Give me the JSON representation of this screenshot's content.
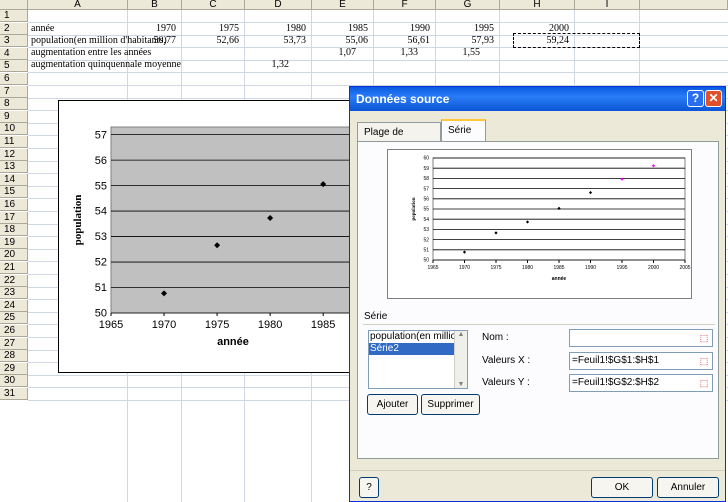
{
  "sheet": {
    "columns": [
      "A",
      "B",
      "C",
      "D",
      "E",
      "F",
      "G",
      "H",
      "I"
    ],
    "rows": [
      "1",
      "2",
      "3",
      "4",
      "5",
      "6",
      "7",
      "8",
      "9",
      "10",
      "11",
      "12",
      "13",
      "14",
      "15",
      "16",
      "17",
      "18",
      "19",
      "20",
      "21",
      "22",
      "23",
      "24",
      "25",
      "26",
      "27",
      "28",
      "29",
      "30",
      "31"
    ],
    "labels": {
      "r1": "année",
      "r2": "population(en million d'habitants)",
      "r3": "augmentation entre les années",
      "r4": "augmentation quinquennale moyenne"
    },
    "row1": [
      "1970",
      "1975",
      "1980",
      "1985",
      "1990",
      "1995",
      "2000"
    ],
    "row2": [
      "50,77",
      "52,66",
      "53,73",
      "55,06",
      "56,61",
      "57,93",
      "59,24"
    ],
    "row3": [
      "1,07",
      "1,33",
      "1,55"
    ],
    "row4": [
      "1,32"
    ]
  },
  "embedded_chart": {
    "type": "scatter",
    "ylabel": "population",
    "xlabel": "année",
    "x_ticks": [
      "1965",
      "1970",
      "1975",
      "1980",
      "1985"
    ],
    "y_ticks": [
      "50",
      "51",
      "52",
      "53",
      "54",
      "55",
      "56",
      "57"
    ]
  },
  "chart_data": [
    {
      "type": "scatter",
      "ylabel": "population",
      "xlabel": "année",
      "xlim": [
        1965,
        1988
      ],
      "ylim": [
        50,
        57.3
      ],
      "x_ticks": [
        "1965",
        "1970",
        "1975",
        "1980",
        "1985"
      ],
      "y_ticks": [
        "50",
        "51",
        "52",
        "53",
        "54",
        "55",
        "56",
        "57"
      ],
      "series": [
        {
          "x": [
            1970,
            1975,
            1980,
            1985
          ],
          "y": [
            50.77,
            52.66,
            53.73,
            55.06
          ]
        }
      ],
      "grid": true,
      "marker_color": "#000000",
      "background": "#c0c0c0"
    },
    {
      "type": "scatter",
      "ylabel": "population",
      "xlabel": "année",
      "xlim": [
        1965,
        2005
      ],
      "ylim": [
        50,
        60
      ],
      "x_ticks": [
        "1965",
        "1970",
        "1975",
        "1980",
        "1985",
        "1990",
        "1995",
        "2000",
        "2005"
      ],
      "y_ticks": [
        "50",
        "51",
        "52",
        "53",
        "54",
        "55",
        "56",
        "57",
        "58",
        "59",
        "60"
      ],
      "series": [
        {
          "x": [
            1970,
            1975,
            1980,
            1985,
            1990
          ],
          "y": [
            50.77,
            52.66,
            53.73,
            55.06,
            56.61
          ],
          "color": "#000000"
        },
        {
          "x": [
            1995,
            2000
          ],
          "y": [
            57.93,
            59.24
          ],
          "color": "#ff00ff"
        }
      ],
      "grid": true
    }
  ],
  "dialog": {
    "title": "Données source",
    "help_glyph": "?",
    "close_glyph": "✕",
    "tabs": [
      "Plage de données",
      "Série"
    ],
    "series_group_label": "Série",
    "series_items": [
      "population(en million",
      "Série2"
    ],
    "nom_label": "Nom :",
    "valeurs_x_label": "Valeurs X :",
    "valeurs_x_value": "=Feuil1!$G$1:$H$1",
    "valeurs_y_label": "Valeurs Y :",
    "valeurs_y_value": "=Feuil1!$G$2:$H$2",
    "nom_value": "",
    "add_button": "Ajouter",
    "remove_button": "Supprimer",
    "ok_button": "OK",
    "cancel_button": "Annuler",
    "help_button": "?"
  },
  "colors": {
    "titlebar": "#0a5ae0",
    "accent_series": "#ff00ff",
    "plot_bg": "#c0c0c0"
  }
}
